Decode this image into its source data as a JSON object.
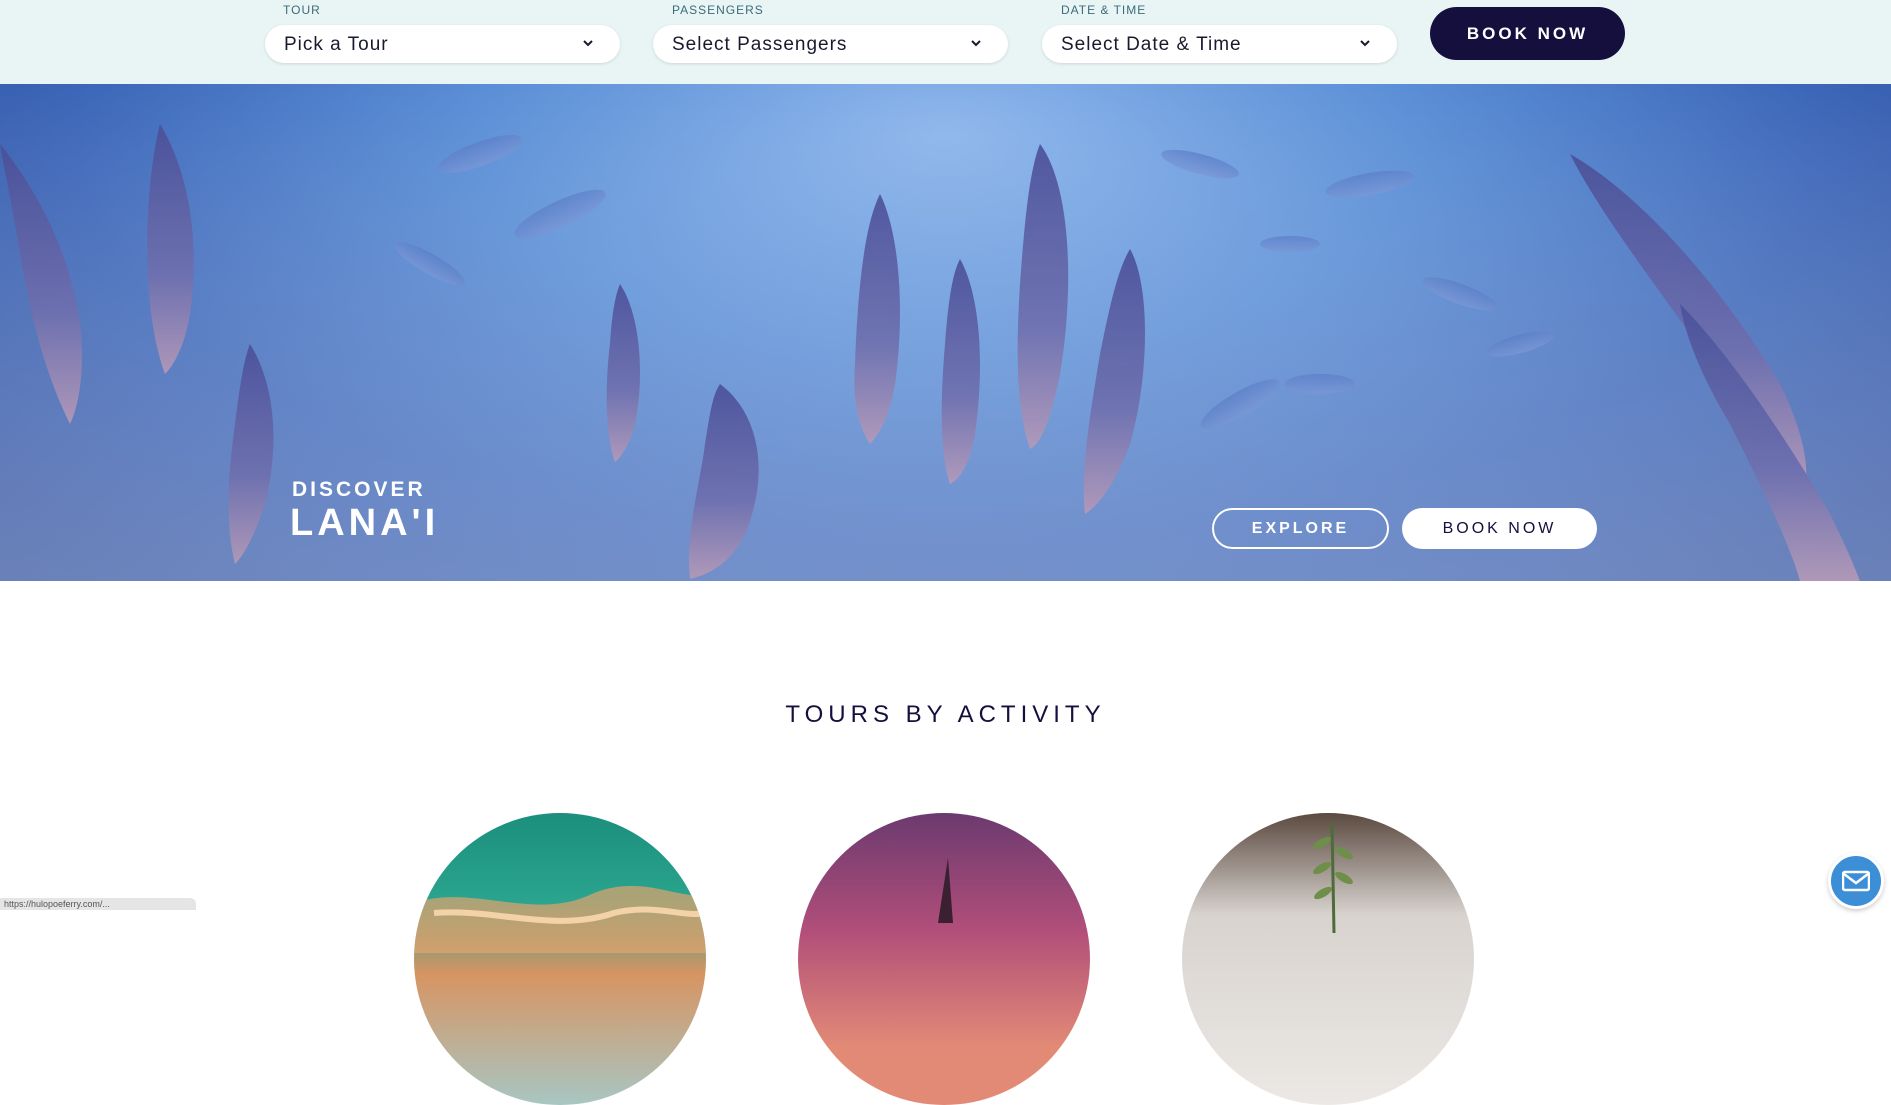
{
  "booking": {
    "tour": {
      "label": "TOUR",
      "value": "Pick a Tour"
    },
    "passengers": {
      "label": "PASSENGERS",
      "value": "Select Passengers"
    },
    "datetime": {
      "label": "DATE & TIME",
      "value": "Select Date & Time"
    },
    "book_label": "BOOK NOW"
  },
  "hero": {
    "kicker": "DISCOVER",
    "title": "LANA'I",
    "explore_label": "EXPLORE",
    "book_label": "BOOK NOW"
  },
  "section": {
    "title": "TOURS BY ACTIVITY"
  },
  "activities": [
    {
      "icon": "snorkel-reef-image"
    },
    {
      "icon": "sunset-sail-image"
    },
    {
      "icon": "dining-herb-image"
    }
  ],
  "status_bar": {
    "text": "https://hulopoeferry.com/..."
  },
  "colors": {
    "bar_bg": "#e9f5f4",
    "navy": "#150f3e",
    "chat": "#3c8ed7"
  }
}
